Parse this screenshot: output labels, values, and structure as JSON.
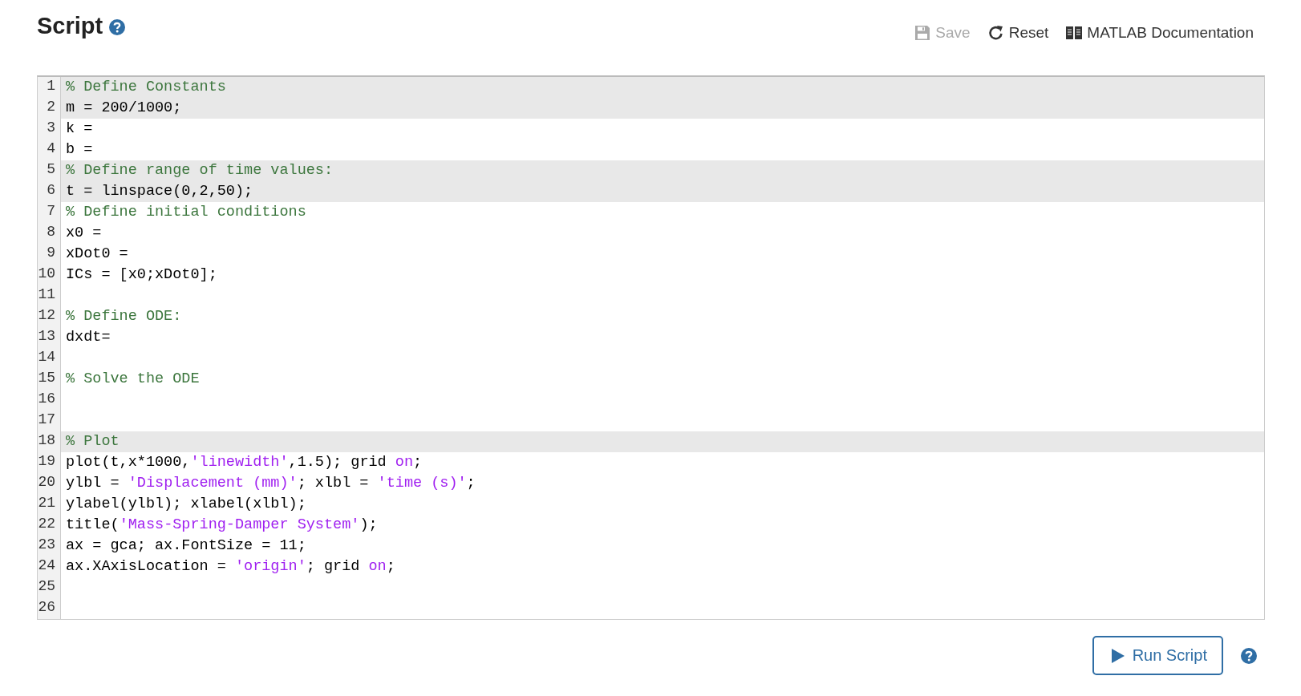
{
  "header": {
    "title": "Script",
    "toolbar": [
      {
        "kind": "save",
        "label": "Save",
        "disabled": true
      },
      {
        "kind": "reset",
        "label": "Reset",
        "disabled": false
      },
      {
        "kind": "docs",
        "label": "MATLAB Documentation",
        "disabled": false
      }
    ]
  },
  "editor": {
    "lines": [
      {
        "number": "1",
        "readonly": true,
        "tokens": [
          {
            "kind": "comment",
            "text": "% Define Constants"
          }
        ]
      },
      {
        "number": "2",
        "readonly": true,
        "tokens": [
          {
            "kind": "code",
            "text": "m = 200/1000;"
          }
        ]
      },
      {
        "number": "3",
        "readonly": false,
        "tokens": [
          {
            "kind": "code",
            "text": "k ="
          }
        ]
      },
      {
        "number": "4",
        "readonly": false,
        "tokens": [
          {
            "kind": "code",
            "text": "b ="
          }
        ]
      },
      {
        "number": "5",
        "readonly": true,
        "tokens": [
          {
            "kind": "comment",
            "text": "% Define range of time values:"
          }
        ]
      },
      {
        "number": "6",
        "readonly": true,
        "tokens": [
          {
            "kind": "code",
            "text": "t = linspace(0,2,50);"
          }
        ]
      },
      {
        "number": "7",
        "readonly": false,
        "tokens": [
          {
            "kind": "comment",
            "text": "% Define initial conditions"
          }
        ]
      },
      {
        "number": "8",
        "readonly": false,
        "tokens": [
          {
            "kind": "code",
            "text": "x0 ="
          }
        ]
      },
      {
        "number": "9",
        "readonly": false,
        "tokens": [
          {
            "kind": "code",
            "text": "xDot0 ="
          }
        ]
      },
      {
        "number": "10",
        "readonly": false,
        "tokens": [
          {
            "kind": "code",
            "text": "ICs = [x0;xDot0];"
          }
        ]
      },
      {
        "number": "11",
        "readonly": false
      },
      {
        "number": "12",
        "readonly": false,
        "tokens": [
          {
            "kind": "comment",
            "text": "% Define ODE:"
          }
        ]
      },
      {
        "number": "13",
        "readonly": false,
        "tokens": [
          {
            "kind": "code",
            "text": "dxdt="
          }
        ]
      },
      {
        "number": "14",
        "readonly": false
      },
      {
        "number": "15",
        "readonly": false,
        "tokens": [
          {
            "kind": "comment",
            "text": "% Solve the ODE"
          }
        ]
      },
      {
        "number": "16",
        "readonly": false
      },
      {
        "number": "17",
        "readonly": false
      },
      {
        "number": "18",
        "readonly": true,
        "tokens": [
          {
            "kind": "comment",
            "text": "% Plot"
          }
        ]
      },
      {
        "number": "19",
        "readonly": false,
        "tokens": [
          {
            "kind": "code",
            "text": "plot(t,x*1000,"
          },
          {
            "kind": "string",
            "text": "'linewidth'"
          },
          {
            "kind": "code",
            "text": ",1.5); grid "
          },
          {
            "kind": "string",
            "text": "on"
          },
          {
            "kind": "code",
            "text": ";"
          }
        ]
      },
      {
        "number": "20",
        "readonly": false,
        "tokens": [
          {
            "kind": "code",
            "text": "ylbl = "
          },
          {
            "kind": "string",
            "text": "'Displacement (mm)'"
          },
          {
            "kind": "code",
            "text": "; xlbl = "
          },
          {
            "kind": "string",
            "text": "'time (s)'"
          },
          {
            "kind": "code",
            "text": ";"
          }
        ]
      },
      {
        "number": "21",
        "readonly": false,
        "tokens": [
          {
            "kind": "code",
            "text": "ylabel(ylbl); xlabel(xlbl);"
          }
        ]
      },
      {
        "number": "22",
        "readonly": false,
        "tokens": [
          {
            "kind": "code",
            "text": "title("
          },
          {
            "kind": "string",
            "text": "'Mass-Spring-Damper System'"
          },
          {
            "kind": "code",
            "text": ");"
          }
        ]
      },
      {
        "number": "23",
        "readonly": false,
        "tokens": [
          {
            "kind": "code",
            "text": "ax = gca; ax.FontSize = 11;"
          }
        ]
      },
      {
        "number": "24",
        "readonly": false,
        "tokens": [
          {
            "kind": "code",
            "text": "ax.XAxisLocation = "
          },
          {
            "kind": "string",
            "text": "'origin'"
          },
          {
            "kind": "code",
            "text": "; grid "
          },
          {
            "kind": "string",
            "text": "on"
          },
          {
            "kind": "code",
            "text": ";"
          }
        ]
      },
      {
        "number": "25",
        "readonly": false
      },
      {
        "number": "26",
        "readonly": false
      }
    ]
  },
  "run_button": {
    "label": "Run Script"
  }
}
